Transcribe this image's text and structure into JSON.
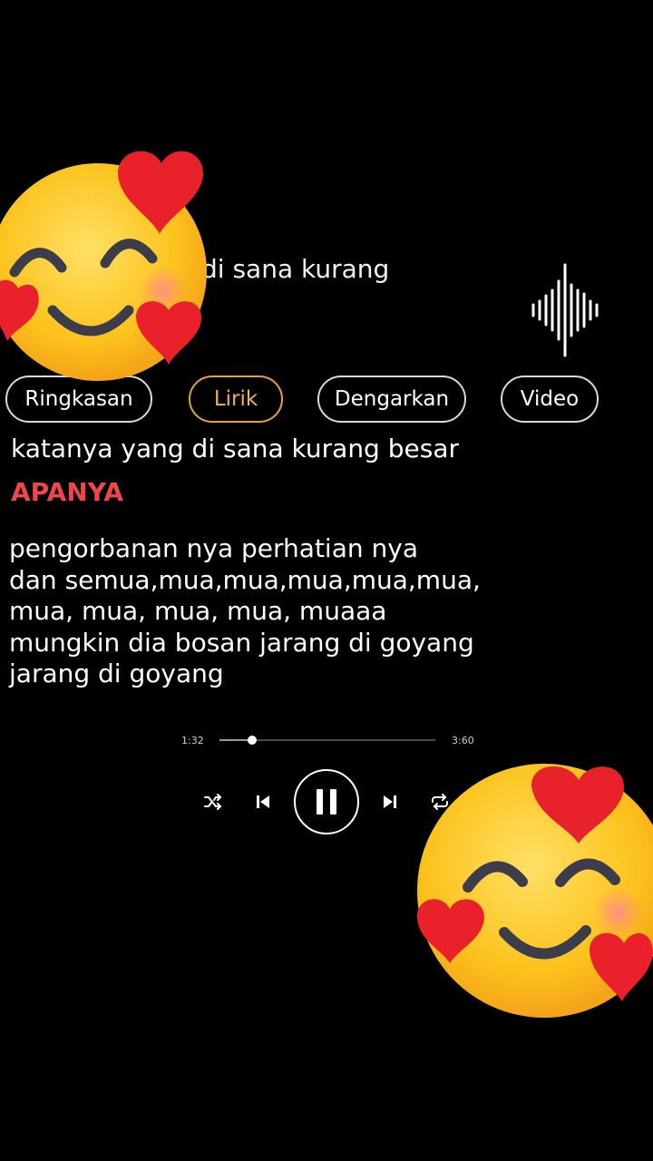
{
  "song": {
    "header_line": "di sana kurang"
  },
  "tabs": [
    {
      "label": "Ringkasan",
      "active": false
    },
    {
      "label": "Lirik",
      "active": true
    },
    {
      "label": "Dengarkan",
      "active": false
    },
    {
      "label": "Video",
      "active": false
    }
  ],
  "lyrics": {
    "current": "katanya yang di sana kurang besar",
    "highlight": "APANYA",
    "lines": [
      "pengorbanan nya perhatian nya",
      "dan semua,mua,mua,mua,mua,mua,",
      "mua, mua, mua, mua, muaaa",
      "mungkin dia bosan jarang di goyang",
      "jarang di goyang"
    ]
  },
  "player": {
    "elapsed": "1:32",
    "duration": "3:60",
    "progress": 0.15,
    "state": "playing"
  },
  "icons": {
    "shuffle": "shuffle-icon",
    "previous": "skip-previous-icon",
    "pause": "pause-icon",
    "next": "skip-next-icon",
    "repeat": "repeat-icon",
    "waveform": "waveform-icon",
    "stickers": "smiling-face-with-hearts-emoji"
  },
  "colors": {
    "background": "#000000",
    "active_tab": "#e3a43a",
    "highlight_text": "#f0454a"
  }
}
